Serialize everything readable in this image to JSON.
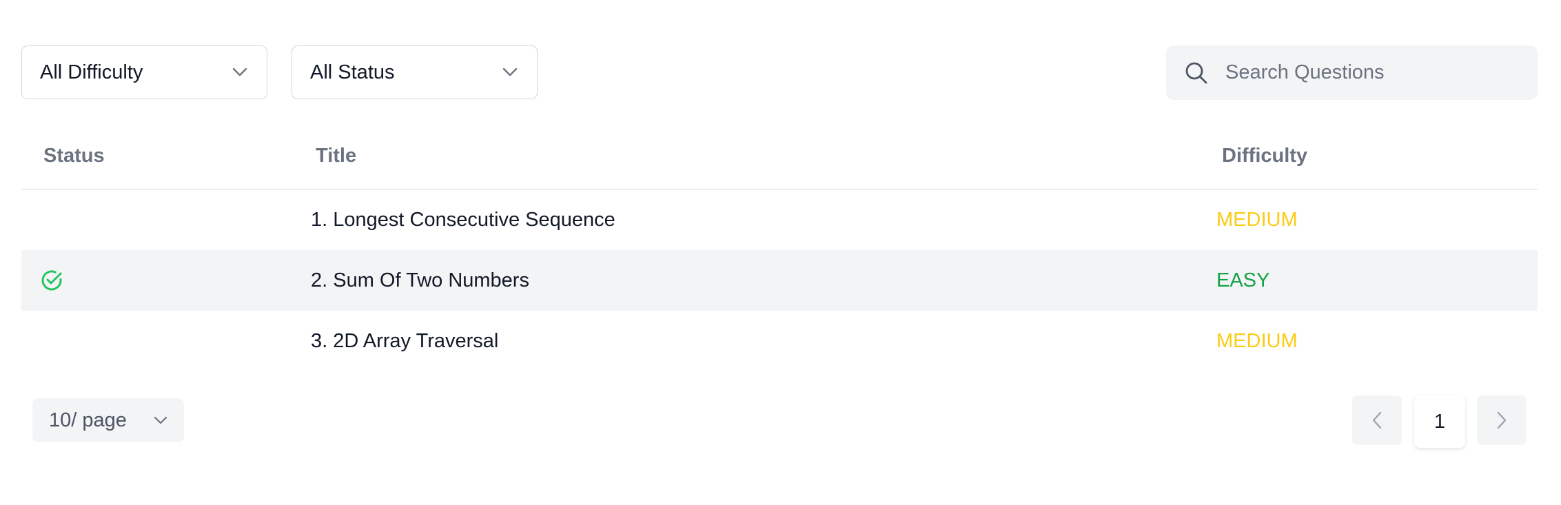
{
  "filters": {
    "difficulty": {
      "label": "All Difficulty"
    },
    "status": {
      "label": "All Status"
    },
    "search": {
      "placeholder": "Search Questions",
      "value": ""
    }
  },
  "table": {
    "headers": {
      "status": "Status",
      "title": "Title",
      "difficulty": "Difficulty"
    },
    "rows": [
      {
        "solved": false,
        "title": "1. Longest Consecutive Sequence",
        "difficulty": "MEDIUM"
      },
      {
        "solved": true,
        "title": "2. Sum Of Two Numbers",
        "difficulty": "EASY"
      },
      {
        "solved": false,
        "title": "3. 2D Array Traversal",
        "difficulty": "MEDIUM"
      }
    ]
  },
  "pagination": {
    "page_size_label": "10/ page",
    "current_page": "1"
  },
  "colors": {
    "medium": "#facc15",
    "easy": "#16a34a",
    "solved_icon": "#22c55e"
  },
  "icons": {
    "dropdown": "chevron-down-icon",
    "search": "search-icon",
    "solved": "check-circle-icon",
    "prev": "chevron-left-icon",
    "next": "chevron-right-icon"
  }
}
